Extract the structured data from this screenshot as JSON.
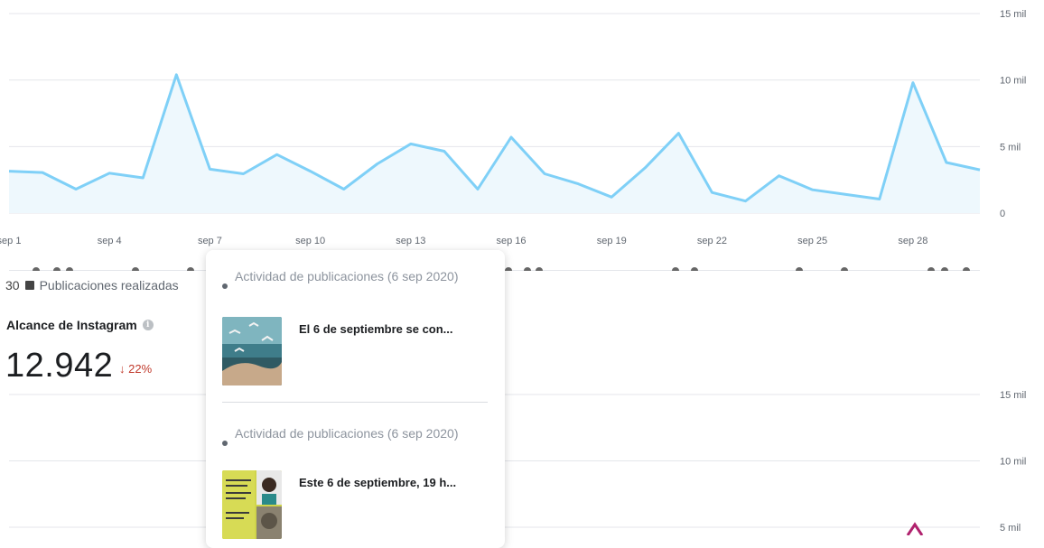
{
  "chart_data": [
    {
      "type": "area",
      "title": "",
      "x": [
        "sep 1",
        "sep 2",
        "sep 3",
        "sep 4",
        "sep 5",
        "sep 6",
        "sep 7",
        "sep 8",
        "sep 9",
        "sep 10",
        "sep 11",
        "sep 12",
        "sep 13",
        "sep 14",
        "sep 15",
        "sep 16",
        "sep 17",
        "sep 18",
        "sep 19",
        "sep 20",
        "sep 21",
        "sep 22",
        "sep 23",
        "sep 24",
        "sep 25",
        "sep 26",
        "sep 27",
        "sep 28",
        "sep 29",
        "sep 30"
      ],
      "x_tick_labels": [
        "sep 1",
        "sep 4",
        "sep 7",
        "sep 10",
        "sep 13",
        "sep 16",
        "sep 19",
        "sep 22",
        "sep 25",
        "sep 28"
      ],
      "y_tick_labels": [
        "15 mil",
        "10 mil",
        "5 mil",
        "0"
      ],
      "ylim": [
        0,
        15000
      ],
      "series": [
        {
          "values": [
            3150,
            3050,
            1800,
            3000,
            2650,
            10400,
            3300,
            2950,
            4400,
            3150,
            1800,
            3700,
            5200,
            4650,
            1800,
            5700,
            2950,
            2200,
            1200,
            3400,
            6000,
            1550,
            900,
            2800,
            1750,
            1400,
            1050,
            9800,
            3800,
            3250
          ]
        }
      ],
      "color": "#7fd0f7",
      "fill": "#eef8fd",
      "grid": true,
      "post_markers": {
        "x": [
          "sep 1",
          "sep 2",
          "sep 2",
          "sep 3",
          "sep 5",
          "sep 7",
          "sep 16",
          "sep 16",
          "sep 21",
          "sep 22",
          "sep 25",
          "sep 27",
          "sep 29",
          "sep 29",
          "sep 30",
          "sep 30"
        ],
        "positions": [
          40,
          63,
          77,
          150,
          211,
          563,
          584,
          597,
          748,
          769,
          885,
          935,
          1031,
          1046,
          1070
        ],
        "color": "#666666"
      },
      "legend": {
        "count": "30",
        "label": "Publicaciones realizadas"
      }
    },
    {
      "type": "line",
      "title": "Alcance de Instagram",
      "total": "12.942",
      "change": "↓ 22%",
      "y_tick_labels": [
        "15 mil",
        "10 mil",
        "5 mil"
      ],
      "ylim": [
        0,
        15000
      ],
      "grid": true
    }
  ],
  "popup": {
    "items": [
      {
        "header": "Actividad de publicaciones (6 sep 2020)",
        "text": "El 6 de septiembre se con..."
      },
      {
        "header": "Actividad de publicaciones (6 sep 2020)",
        "text": "Este 6 de septiembre, 19 h..."
      }
    ]
  },
  "colors": {
    "line": "#7fd0f7",
    "grid": "#e4e6eb",
    "down": "#c0392b"
  }
}
